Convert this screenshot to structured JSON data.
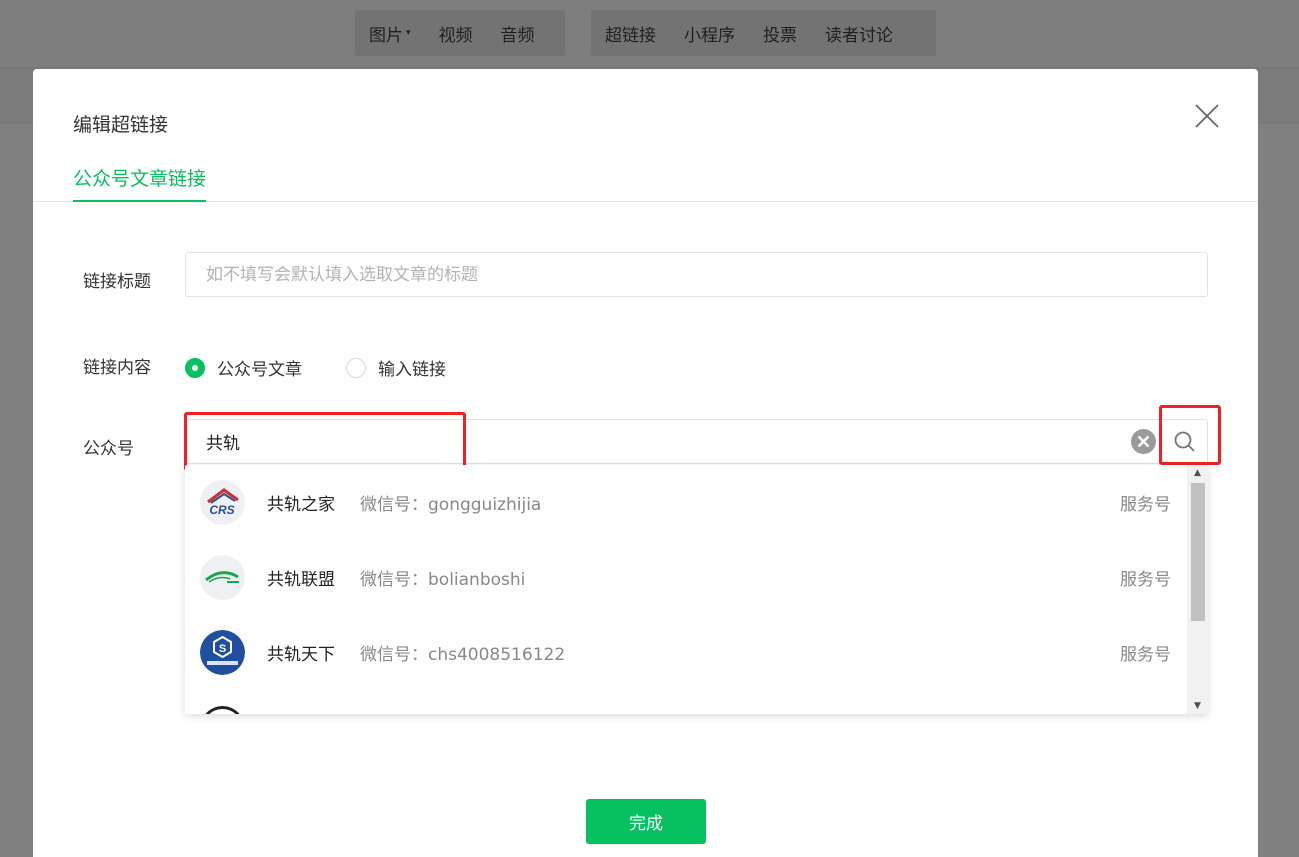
{
  "toolbar": {
    "group1": [
      "图片",
      "视频",
      "音频"
    ],
    "group2": [
      "超链接",
      "小程序",
      "投票",
      "读者讨论"
    ]
  },
  "dialog": {
    "title": "编辑超链接",
    "tab": "公众号文章链接",
    "link_title_label": "链接标题",
    "link_title_placeholder": "如不填写会默认填入选取文章的标题",
    "link_content_label": "链接内容",
    "radio_article": "公众号文章",
    "radio_link": "输入链接",
    "account_label": "公众号",
    "account_value": "共轨",
    "done": "完成"
  },
  "results": [
    {
      "name": "共轨之家",
      "wechat": "微信号：gongguizhijia",
      "type": "服务号",
      "avatar": "crs-logo"
    },
    {
      "name": "共轨联盟",
      "wechat": "微信号：bolianboshi",
      "type": "服务号",
      "avatar": "green-swoosh-logo"
    },
    {
      "name": "共轨天下",
      "wechat": "微信号：chs4008516122",
      "type": "服务号",
      "avatar": "blue-circle-logo"
    }
  ],
  "colors": {
    "accent": "#07c160",
    "highlight": "#ee2222",
    "overlay": "#808080"
  }
}
